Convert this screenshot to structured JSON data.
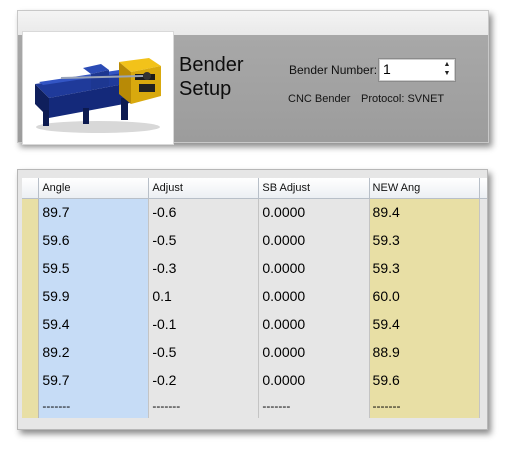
{
  "header": {
    "title_line1": "Bender",
    "title_line2": "Setup",
    "bender_number_label": "Bender Number:",
    "bender_number_value": "1",
    "machine_type": "CNC Bender",
    "protocol": "Protocol: SVNET",
    "image_icon": "tube-bender-machine-photo"
  },
  "grid": {
    "columns": [
      "Angle",
      "Adjust",
      "SB Adjust",
      "NEW Ang"
    ],
    "rows": [
      [
        "89.7",
        "-0.6",
        "0.0000",
        "89.4"
      ],
      [
        "59.6",
        "-0.5",
        "0.0000",
        "59.3"
      ],
      [
        "59.5",
        "-0.3",
        "0.0000",
        "59.3"
      ],
      [
        "59.9",
        "0.1",
        "0.0000",
        "60.0"
      ],
      [
        "59.4",
        "-0.1",
        "0.0000",
        "59.4"
      ],
      [
        "89.2",
        "-0.5",
        "0.0000",
        "88.9"
      ],
      [
        "59.7",
        "-0.2",
        "0.0000",
        "59.6"
      ],
      [
        "-------",
        "-------",
        "-------",
        "-------"
      ]
    ]
  },
  "colors": {
    "angle_column": "#c6dcf6",
    "new_angle_column": "#e8dfa5",
    "row_header": "#e8dfa5",
    "neutral_column": "#e6e6e6",
    "header_band": "#a3a3a3"
  }
}
